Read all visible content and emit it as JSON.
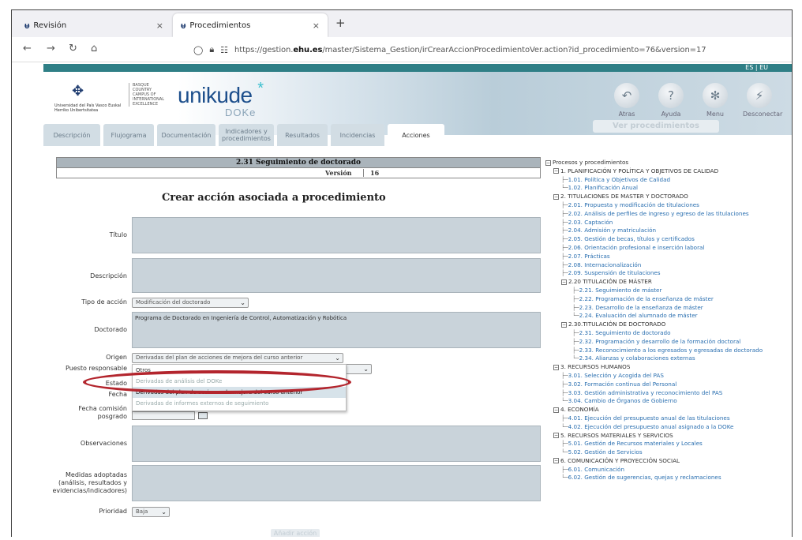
{
  "browser": {
    "tabs": [
      {
        "label": "Revisión",
        "favicon": "ehu-favicon",
        "close": "×"
      },
      {
        "label": "Procedimientos",
        "favicon": "ehu-favicon",
        "close": "×"
      }
    ],
    "new_tab": "+",
    "nav": {
      "back": "←",
      "forward": "→",
      "reload": "↻",
      "home": "⌂"
    },
    "url_prefix": "https://gestion.",
    "url_domain": "ehu.es",
    "url_suffix": "/master/Sistema_Gestion/irCrearAccionProcedimientoVer.action?id_procedimiento=76&version=17"
  },
  "header": {
    "ehu_name": "Universidad del País Vasco   Euskal Herriko Unibertsitatea",
    "ehu_side": "BASQUE COUNTRY CAMPUS OF INTERNATIONAL EXCELLENCE",
    "app_name": "unikude",
    "app_star": "*",
    "app_sub": "DOKe",
    "icons": [
      {
        "label": "Atras",
        "glyph": "↶"
      },
      {
        "label": "Ayuda",
        "glyph": "?"
      },
      {
        "label": "Menu",
        "glyph": "✻"
      },
      {
        "label": "Desconectar",
        "glyph": "⚡"
      }
    ],
    "ver_procedimientos": "Ver procedimientos",
    "lang": "ES | EU"
  },
  "nav_tabs": [
    {
      "label": "Descripción",
      "w": 72
    },
    {
      "label": "Flujograma",
      "w": 64
    },
    {
      "label": "Documentación",
      "w": 74
    },
    {
      "label": "Indicadores y procedimientos",
      "w": 70
    },
    {
      "label": "Resultados",
      "w": 64
    },
    {
      "label": "Incidencias",
      "w": 68
    },
    {
      "label": "Acciones",
      "w": 72,
      "active": true
    }
  ],
  "procedure": {
    "title": "2.31 Seguimiento de doctorado",
    "version_label": "Versión",
    "version": "16"
  },
  "form": {
    "title": "Crear acción asociada a procedimiento",
    "labels": {
      "titulo": "Título",
      "descripcion": "Descripción",
      "tipo_accion": "Tipo de acción",
      "doctorado": "Doctorado",
      "origen": "Origen",
      "puesto": "Puesto responsable",
      "estado": "Estado",
      "fecha": "Fecha",
      "fecha_comision": "Fecha comisión posgrado",
      "observaciones": "Observaciones",
      "medidas": "Medidas adoptadas (análisis, resultados y evidencias/indicadores)",
      "prioridad": "Prioridad"
    },
    "tipo_accion_value": "Modificación del doctorado",
    "doctorado_value": "Programa de Doctorado en Ingeniería de Control, Automatización y Robótica",
    "origen_value": "Derivadas del plan de acciones de mejora del curso anterior",
    "origen_options": [
      "Otros",
      "Derivadas de análisis del DOKe",
      "Derivadas del plan de acciones de mejora del curso anterior",
      "Derivadas de informes externos de seguimiento"
    ],
    "selected_option_index": 2,
    "prioridad_value": "Baja",
    "add_button": "Añadir acción",
    "select_arrow": "⌄"
  },
  "tree": {
    "root": "Procesos y procedimientos",
    "nodes": [
      {
        "text": "1. PLANIFICACIÓN Y POLÍTICA Y OBJETIVOS DE CALIDAD",
        "level": "l1",
        "box": "−"
      },
      {
        "text": "1.01. Política y Objetivos de Calidad",
        "level": "l2",
        "branch": "├─"
      },
      {
        "text": "1.02. Planificación Anual",
        "level": "l2",
        "branch": "└─"
      },
      {
        "text": "2. TITULACIONES DE MASTER Y DOCTORADO",
        "level": "l1",
        "box": "−"
      },
      {
        "text": "2.01. Propuesta y modificación de titulaciones",
        "level": "l2",
        "branch": "├─"
      },
      {
        "text": "2.02. Análisis de perfiles de ingreso y egreso de las titulaciones",
        "level": "l2",
        "branch": "├─"
      },
      {
        "text": "2.03. Captación",
        "level": "l2",
        "branch": "├─"
      },
      {
        "text": "2.04. Admisión y matriculación",
        "level": "l2",
        "branch": "├─"
      },
      {
        "text": "2.05. Gestión de becas, títulos y certificados",
        "level": "l2",
        "branch": "├─"
      },
      {
        "text": "2.06. Orientación profesional e inserción laboral",
        "level": "l2",
        "branch": "├─"
      },
      {
        "text": "2.07. Prácticas",
        "level": "l2",
        "branch": "├─"
      },
      {
        "text": "2.08. Internacionalización",
        "level": "l2",
        "branch": "├─"
      },
      {
        "text": "2.09. Suspensión de titulaciones",
        "level": "l2",
        "branch": "├─"
      },
      {
        "text": "2.20 TITULACIÓN DE MÁSTER",
        "level": "l2b",
        "box": "−"
      },
      {
        "text": "2.21. Seguimiento de máster",
        "level": "l3",
        "branch": "├─"
      },
      {
        "text": "2.22. Programación de la enseñanza de máster",
        "level": "l3",
        "branch": "├─"
      },
      {
        "text": "2.23. Desarrollo de la enseñanza de máster",
        "level": "l3",
        "branch": "├─"
      },
      {
        "text": "2.24. Evaluación del alumnado de máster",
        "level": "l3",
        "branch": "└─"
      },
      {
        "text": "2.30.TITULACIÓN DE DOCTORADO",
        "level": "l2b",
        "box": "−"
      },
      {
        "text": "2.31. Seguimiento de doctorado",
        "level": "l3",
        "branch": "├─"
      },
      {
        "text": "2.32. Programación y desarrollo de la formación doctoral",
        "level": "l3",
        "branch": "├─"
      },
      {
        "text": "2.33. Reconocimiento a los egresados y egresadas de doctorado",
        "level": "l3",
        "branch": "├─"
      },
      {
        "text": "2.34. Alianzas y colaboraciones externas",
        "level": "l3",
        "branch": "└─"
      },
      {
        "text": "3. RECURSOS HUMANOS",
        "level": "l1",
        "box": "−"
      },
      {
        "text": "3.01. Selección y Acogida del PAS",
        "level": "l2",
        "branch": "├─"
      },
      {
        "text": "3.02. Formación continua del Personal",
        "level": "l2",
        "branch": "├─"
      },
      {
        "text": "3.03. Gestión administrativa y reconocimiento del PAS",
        "level": "l2",
        "branch": "├─"
      },
      {
        "text": "3.04. Cambio de Órganos de Gobierno",
        "level": "l2",
        "branch": "└─"
      },
      {
        "text": "4. ECONOMÍA",
        "level": "l1",
        "box": "−"
      },
      {
        "text": "4.01. Ejecución del presupuesto anual de las titulaciones",
        "level": "l2",
        "branch": "├─"
      },
      {
        "text": "4.02. Ejecución del presupuesto anual asignado a la DOKe",
        "level": "l2",
        "branch": "└─"
      },
      {
        "text": "5. RECURSOS MATERIALES Y SERVICIOS",
        "level": "l1",
        "box": "−"
      },
      {
        "text": "5.01. Gestión de Recursos materiales y Locales",
        "level": "l2",
        "branch": "├─"
      },
      {
        "text": "5.02. Gestión de Servicios",
        "level": "l2",
        "branch": "└─"
      },
      {
        "text": "6. COMUNICACIÓN Y PROYECCIÓN SOCIAL",
        "level": "l1",
        "box": "−"
      },
      {
        "text": "6.01. Comunicación",
        "level": "l2",
        "branch": "├─"
      },
      {
        "text": "6.02. Gestión de sugerencias, quejas y reclamaciones",
        "level": "l2",
        "branch": "└─"
      }
    ]
  },
  "colors": {
    "teal": "#2f7f86",
    "highlight_ring": "#b3252d",
    "field_bg": "#c9d3da",
    "link": "#2a6fb0"
  }
}
